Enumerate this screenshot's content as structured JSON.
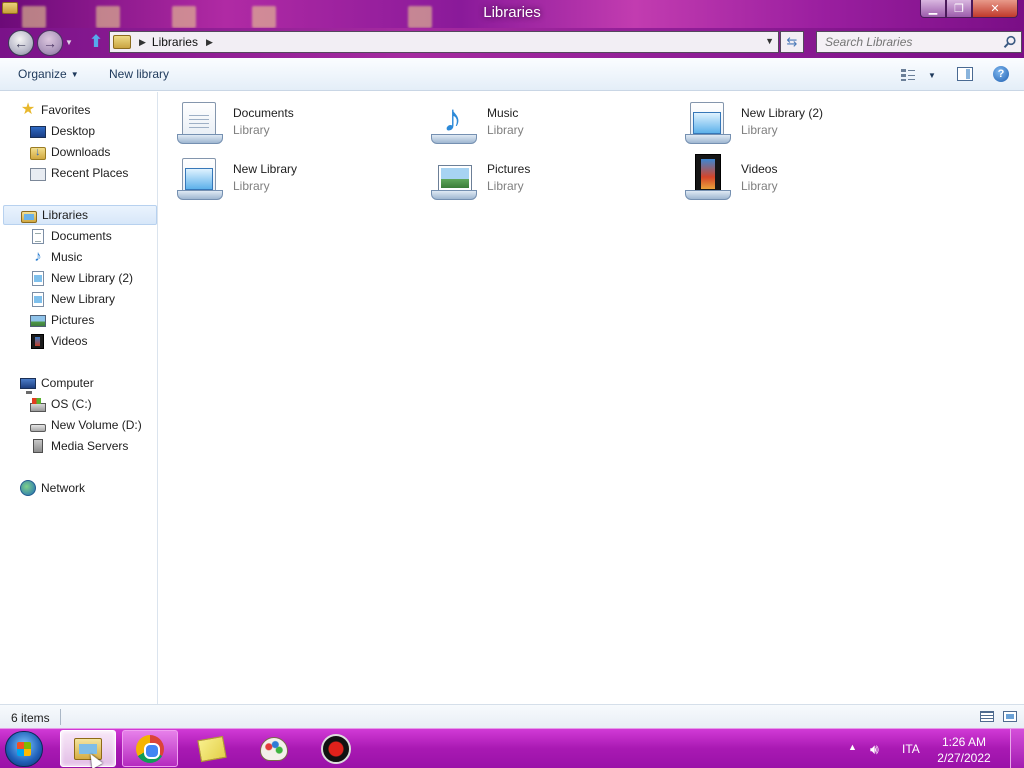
{
  "window": {
    "title": "Libraries"
  },
  "address": {
    "breadcrumb": [
      "Libraries"
    ],
    "search_placeholder": "Search Libraries"
  },
  "toolbar": {
    "organize_label": "Organize",
    "new_library_label": "New library"
  },
  "nav": {
    "favorites": {
      "label": "Favorites",
      "items": [
        {
          "label": "Desktop",
          "icon": "desktop-icon"
        },
        {
          "label": "Downloads",
          "icon": "downloads-icon"
        },
        {
          "label": "Recent Places",
          "icon": "recent-places-icon"
        }
      ]
    },
    "libraries": {
      "label": "Libraries",
      "selected": true,
      "items": [
        {
          "label": "Documents",
          "icon": "documents-icon"
        },
        {
          "label": "Music",
          "icon": "music-icon"
        },
        {
          "label": "New Library (2)",
          "icon": "library-icon"
        },
        {
          "label": "New Library",
          "icon": "library-icon"
        },
        {
          "label": "Pictures",
          "icon": "pictures-icon"
        },
        {
          "label": "Videos",
          "icon": "videos-icon"
        }
      ]
    },
    "computer": {
      "label": "Computer",
      "items": [
        {
          "label": "OS (C:)",
          "icon": "drive-c-icon"
        },
        {
          "label": "New Volume (D:)",
          "icon": "drive-d-icon"
        },
        {
          "label": "Media Servers",
          "icon": "media-server-icon"
        }
      ]
    },
    "network": {
      "label": "Network"
    }
  },
  "content": {
    "items": [
      {
        "name": "Documents",
        "type": "Library",
        "icon": "documents-library-icon"
      },
      {
        "name": "Music",
        "type": "Library",
        "icon": "music-library-icon"
      },
      {
        "name": "New Library (2)",
        "type": "Library",
        "icon": "library-icon"
      },
      {
        "name": "New Library",
        "type": "Library",
        "icon": "library-icon"
      },
      {
        "name": "Pictures",
        "type": "Library",
        "icon": "pictures-library-icon"
      },
      {
        "name": "Videos",
        "type": "Library",
        "icon": "videos-library-icon"
      }
    ]
  },
  "status": {
    "item_count": "6 items"
  },
  "taskbar": {
    "apps": [
      "Windows Explorer",
      "Google Chrome",
      "Sticky Notes",
      "Paint",
      "Recorder"
    ],
    "active_app": "Windows Explorer",
    "language": "ITA",
    "time": "1:26 AM",
    "date": "2/27/2022"
  },
  "colors": {
    "titlebar_accent": "#a919b3",
    "taskbar": "#b52bbf",
    "selection": "#d7e7f9"
  }
}
